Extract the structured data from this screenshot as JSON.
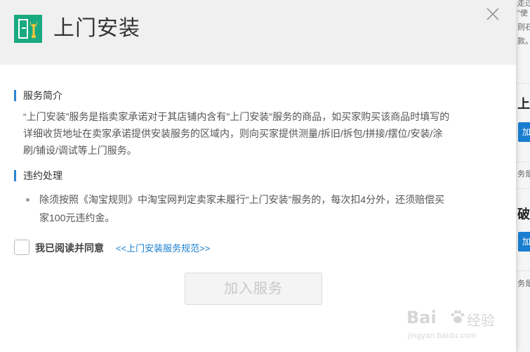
{
  "dialog": {
    "title": "上门安装",
    "close_icon": "close-icon",
    "logo_icon": "door-wrench-icon"
  },
  "sections": {
    "intro_heading": "服务简介",
    "intro_text_line1": "“上门安装”服务是指卖家承诺对于其店铺内含有\"上门安装\"服务的商品，如买家购买该商品时填写的",
    "intro_text_line2": "详细收货地址在卖家承诺提供安装服务的区域内，则向买家提供测量/拆旧/拆包/拼接/摆位/安装/涂",
    "intro_text_line3": "刷/铺设/调试等上门服务。",
    "violation_heading": "违约处理",
    "violation_line1": "除须按照《淘宝规则》中淘宝网判定卖家未履行“上门安装”服务的，每次扣4分外，还须赔偿买",
    "violation_line2": "家100元违约金。"
  },
  "agreement": {
    "label": "我已阅读并同意",
    "link": "<<上门安装服务规范>>",
    "checked": false
  },
  "action": {
    "join_label": "加入服务",
    "enabled": false
  },
  "background_page": {
    "frag_top_1": "走过",
    "frag_top_2": "\"使",
    "frag_top_3": "则石",
    "frag_top_4": "款。",
    "heading_1": "上",
    "button_1": "加",
    "frag_mid_1": "务是",
    "heading_2": "破",
    "button_2": "加",
    "frag_mid_2": "务是"
  },
  "watermark": {
    "brand": "Bai",
    "brand_cn": "经验",
    "url": "jingyan.baidu.com"
  },
  "colors": {
    "accent": "#2b86d4",
    "link": "#1a7fd0",
    "logo_bg": "#19a980",
    "header_bg": "#f0f0f0"
  }
}
